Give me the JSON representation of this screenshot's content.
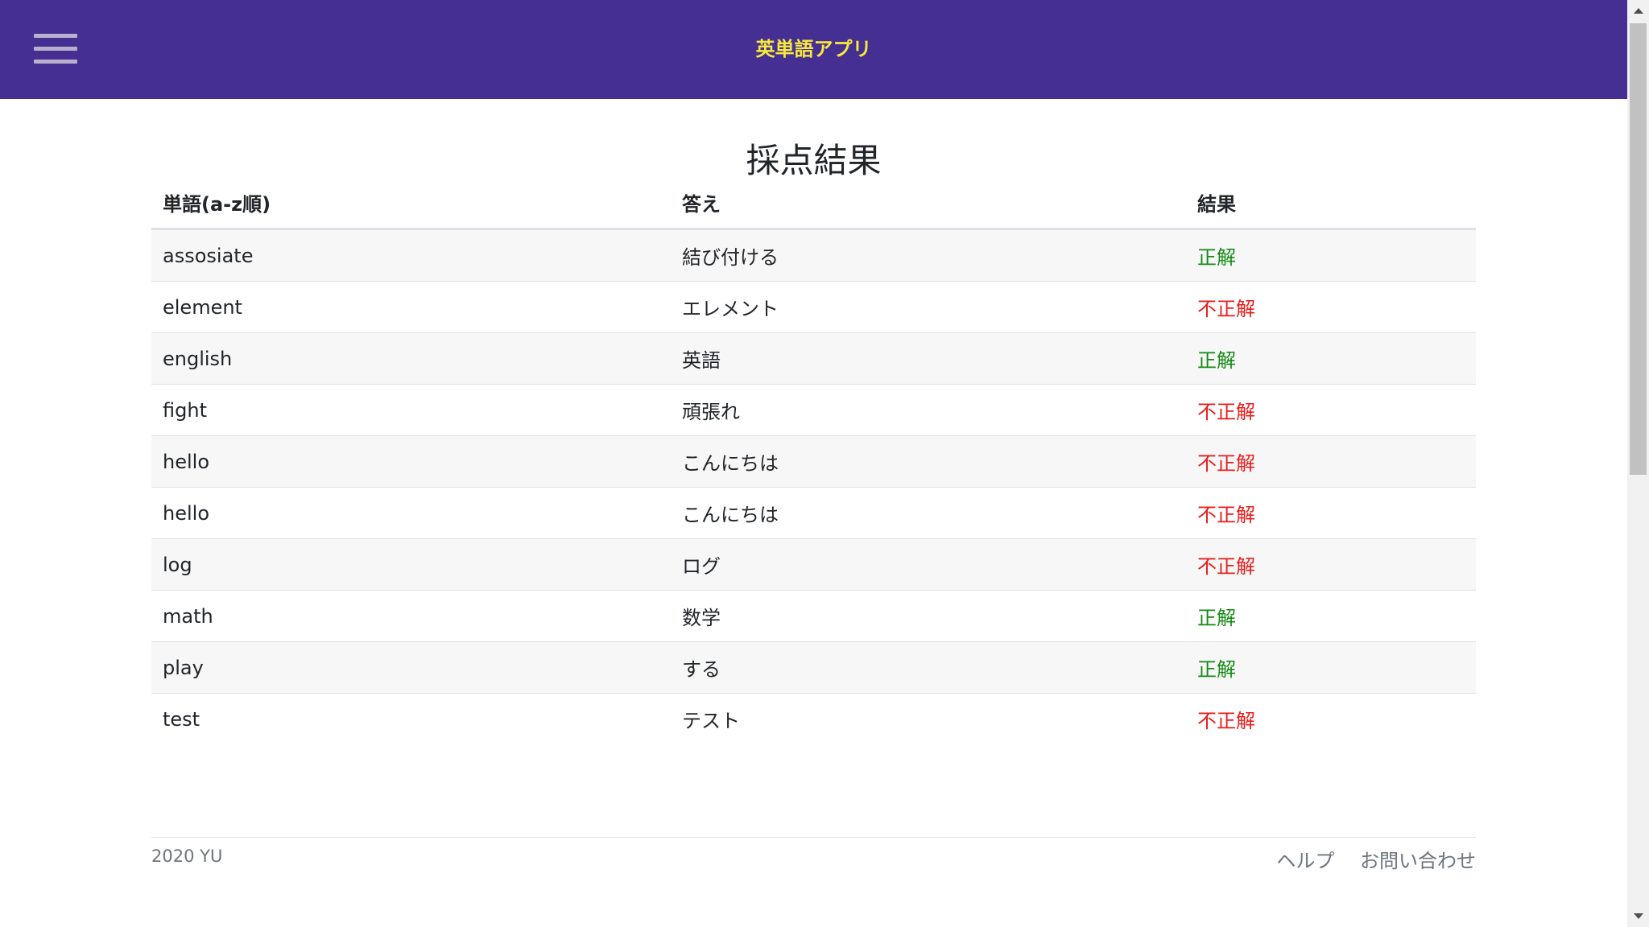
{
  "navbar": {
    "menu_icon": "hamburger-menu-icon",
    "brand": "英単語アプリ",
    "background_color": "#452f93",
    "brand_color": "#f7e93b"
  },
  "page": {
    "title": "採点結果"
  },
  "table": {
    "headers": {
      "word": "単語(a-z順)",
      "answer": "答え",
      "result": "結果"
    },
    "rows": [
      {
        "word": "assosiate",
        "answer": "結び付ける",
        "result": "正解",
        "correct": true
      },
      {
        "word": "element",
        "answer": "エレメント",
        "result": "不正解",
        "correct": false
      },
      {
        "word": "english",
        "answer": "英語",
        "result": "正解",
        "correct": true
      },
      {
        "word": "fight",
        "answer": "頑張れ",
        "result": "不正解",
        "correct": false
      },
      {
        "word": "hello",
        "answer": "こんにちは",
        "result": "不正解",
        "correct": false
      },
      {
        "word": "hello",
        "answer": "こんにちは",
        "result": "不正解",
        "correct": false
      },
      {
        "word": "log",
        "answer": "ログ",
        "result": "不正解",
        "correct": false
      },
      {
        "word": "math",
        "answer": "数学",
        "result": "正解",
        "correct": true
      },
      {
        "word": "play",
        "answer": "する",
        "result": "正解",
        "correct": true
      },
      {
        "word": "test",
        "answer": "テスト",
        "result": "不正解",
        "correct": false
      }
    ],
    "correct_color": "#148a14",
    "wrong_color": "#e81c1c"
  },
  "footer": {
    "copyright": "2020 YU",
    "links": {
      "help": "ヘルプ",
      "contact": "お問い合わせ"
    }
  }
}
